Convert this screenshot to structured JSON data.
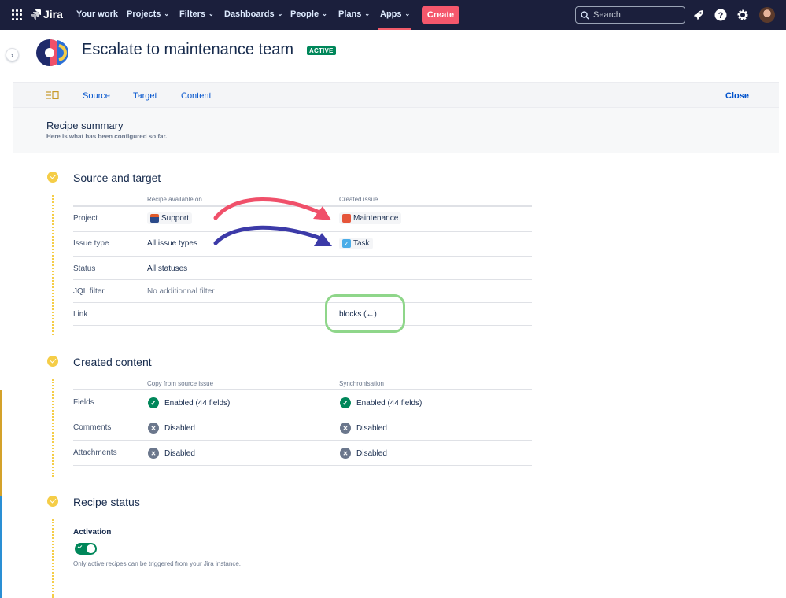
{
  "topnav": {
    "product": "Jira",
    "items": [
      {
        "label": "Your work",
        "has_dropdown": false
      },
      {
        "label": "Projects",
        "has_dropdown": true
      },
      {
        "label": "Filters",
        "has_dropdown": true
      },
      {
        "label": "Dashboards",
        "has_dropdown": true
      },
      {
        "label": "People",
        "has_dropdown": true
      },
      {
        "label": "Plans",
        "has_dropdown": true
      },
      {
        "label": "Apps",
        "has_dropdown": true
      }
    ],
    "active_item": "Apps",
    "create_label": "Create",
    "search_placeholder": "Search",
    "icons": [
      "app-switcher-icon",
      "rocket-icon",
      "help-icon",
      "gear-icon",
      "avatar"
    ]
  },
  "header": {
    "title": "Escalate to maintenance team",
    "status_badge": "ACTIVE"
  },
  "tabs": {
    "items": [
      "Source",
      "Target",
      "Content"
    ],
    "close_label": "Close"
  },
  "summary": {
    "title": "Recipe summary",
    "subtitle": "Here is what has been configured so far."
  },
  "source_target": {
    "title": "Source and target",
    "col1_header": "Recipe available on",
    "col2_header": "Created issue",
    "rows": [
      {
        "label": "Project",
        "source": "Support",
        "target": "Maintenance"
      },
      {
        "label": "Issue type",
        "source": "All issue types",
        "target": "Task"
      },
      {
        "label": "Status",
        "source": "All statuses",
        "target": ""
      },
      {
        "label": "JQL filter",
        "source": "No additionnal filter",
        "target": ""
      },
      {
        "label": "Link",
        "source": "",
        "target": "blocks (←)"
      }
    ]
  },
  "created_content": {
    "title": "Created content",
    "col1_header": "Copy from source issue",
    "col2_header": "Synchronisation",
    "rows": [
      {
        "label": "Fields",
        "copy": "Enabled (44 fields)",
        "copy_state": "enabled",
        "sync": "Enabled (44 fields)",
        "sync_state": "enabled"
      },
      {
        "label": "Comments",
        "copy": "Disabled",
        "copy_state": "disabled",
        "sync": "Disabled",
        "sync_state": "disabled"
      },
      {
        "label": "Attachments",
        "copy": "Disabled",
        "copy_state": "disabled",
        "sync": "Disabled",
        "sync_state": "disabled"
      }
    ]
  },
  "recipe_status": {
    "title": "Recipe status",
    "activation_label": "Activation",
    "activation_on": true,
    "help_text": "Only active recipes can be triggered from your Jira instance."
  },
  "colors": {
    "nav_bg": "#1b1f3c",
    "create": "#f5576c",
    "active_badge": "#00875a",
    "section_dot": "#f5cd47",
    "arrow_red": "#f0506a",
    "arrow_blue": "#3c3aa8",
    "highlight_ring": "#8fd68a"
  }
}
